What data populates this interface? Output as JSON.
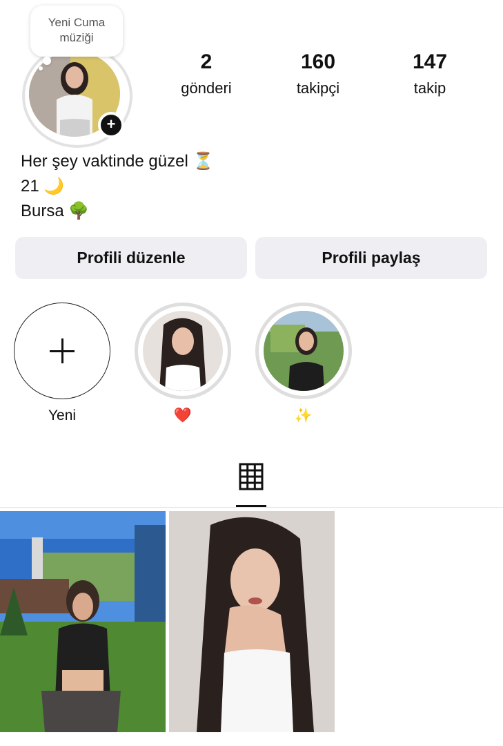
{
  "profile": {
    "note": "Yeni Cuma müziği",
    "stats": [
      {
        "value": "2",
        "label": "gönderi"
      },
      {
        "value": "160",
        "label": "takipçi"
      },
      {
        "value": "147",
        "label": "takip"
      }
    ],
    "bio": [
      "Her şey vaktinde güzel ⏳",
      "21 🌙",
      "Bursa 🌳"
    ]
  },
  "actions": {
    "edit": "Profili düzenle",
    "share": "Profili paylaş"
  },
  "highlights": [
    {
      "label": "Yeni"
    },
    {
      "label": "❤️"
    },
    {
      "label": "✨"
    }
  ],
  "tabs": {
    "active": "grid-icon"
  },
  "colors": {
    "button_bg": "#efeff3",
    "ring": "#dedede"
  }
}
